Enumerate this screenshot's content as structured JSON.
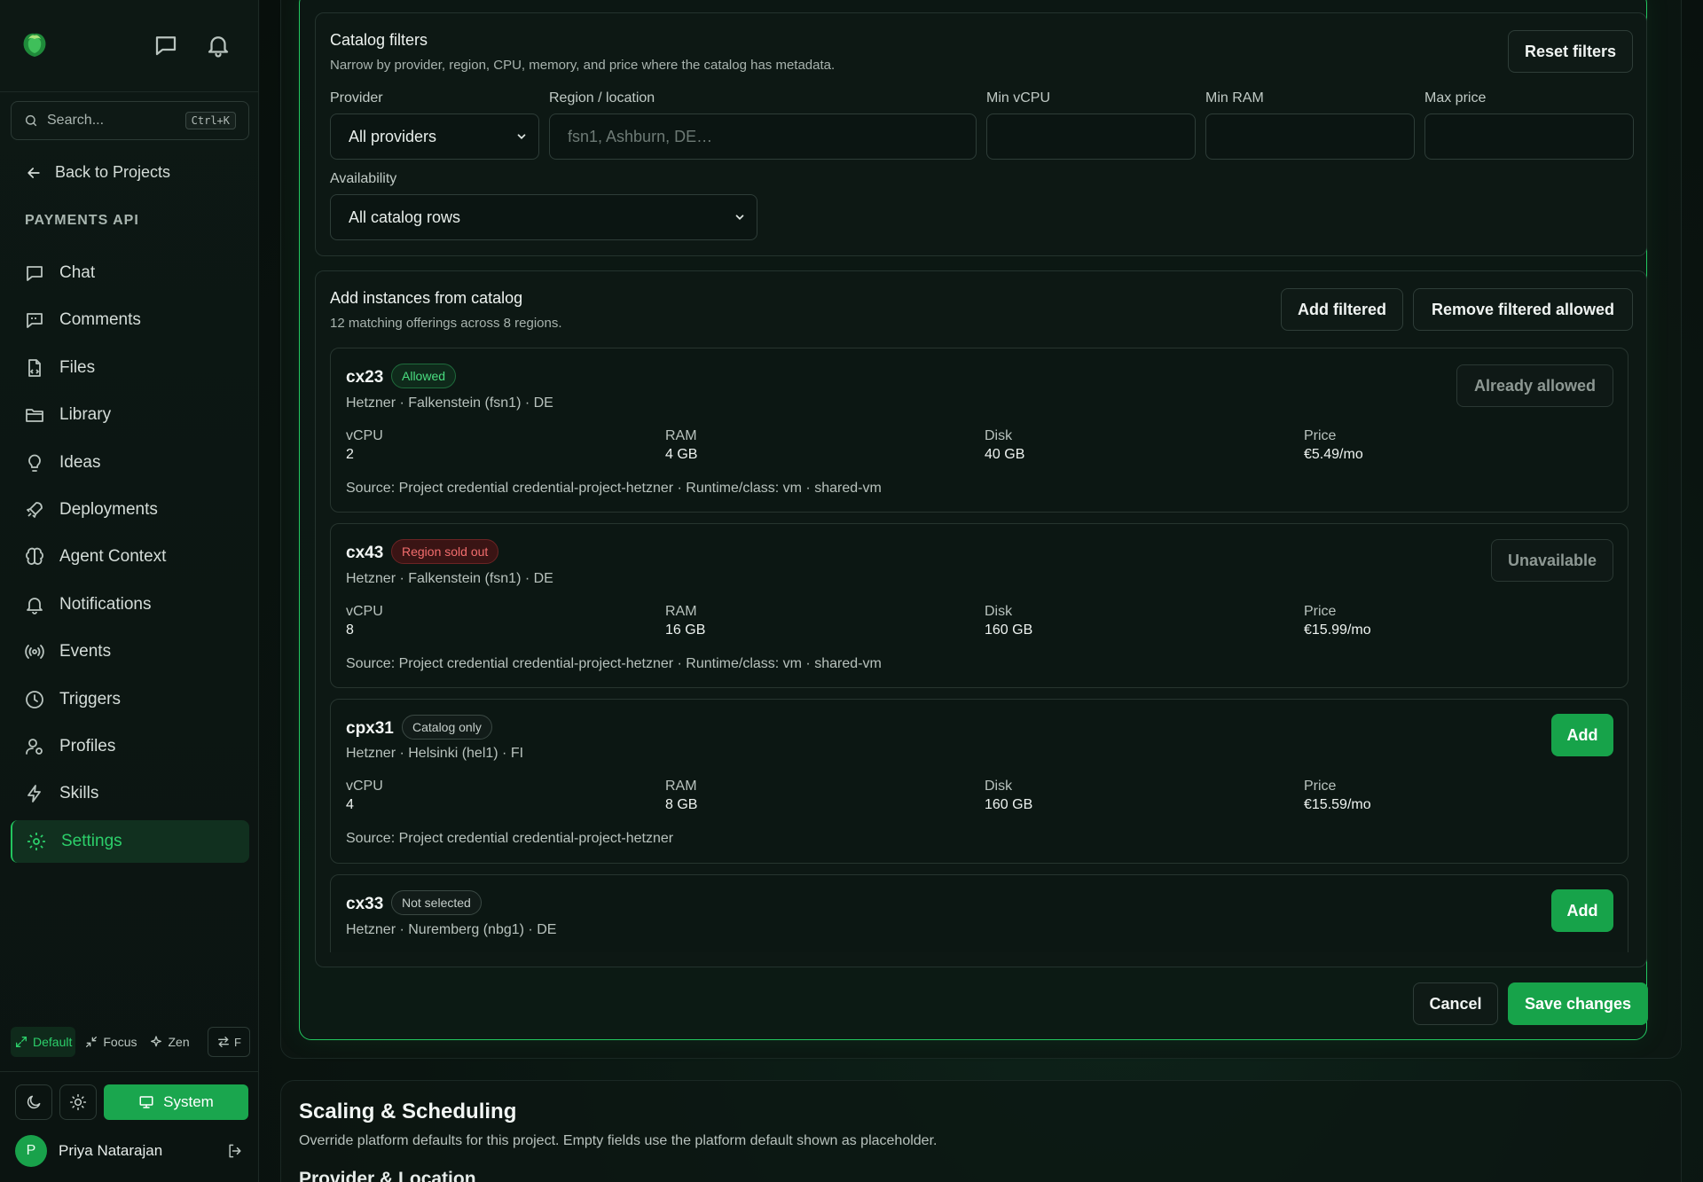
{
  "sidebar": {
    "search_placeholder": "Search...",
    "search_shortcut": "Ctrl+K",
    "back_label": "Back to Projects",
    "project_name": "PAYMENTS API",
    "nav": [
      {
        "label": "Chat",
        "icon": "chat-icon"
      },
      {
        "label": "Comments",
        "icon": "comments-icon"
      },
      {
        "label": "Files",
        "icon": "file-icon"
      },
      {
        "label": "Library",
        "icon": "folder-icon"
      },
      {
        "label": "Ideas",
        "icon": "lightbulb-icon"
      },
      {
        "label": "Deployments",
        "icon": "rocket-icon"
      },
      {
        "label": "Agent Context",
        "icon": "brain-icon"
      },
      {
        "label": "Notifications",
        "icon": "bell-icon"
      },
      {
        "label": "Events",
        "icon": "broadcast-icon"
      },
      {
        "label": "Triggers",
        "icon": "clock-icon"
      },
      {
        "label": "Profiles",
        "icon": "user-cog-icon"
      },
      {
        "label": "Skills",
        "icon": "lightning-icon"
      },
      {
        "label": "Settings",
        "icon": "gear-icon",
        "active": true
      }
    ],
    "modes": {
      "default": "Default",
      "focus": "Focus",
      "zen": "Zen",
      "swap": "F"
    },
    "theme_system": "System",
    "user_name": "Priya Natarajan",
    "user_initial": "P"
  },
  "filters": {
    "title": "Catalog filters",
    "subtitle": "Narrow by provider, region, CPU, memory, and price where the catalog has metadata.",
    "reset_label": "Reset filters",
    "provider_label": "Provider",
    "provider_value": "All providers",
    "region_label": "Region / location",
    "region_placeholder": "fsn1, Ashburn, DE…",
    "min_vcpu_label": "Min vCPU",
    "min_ram_label": "Min RAM",
    "max_price_label": "Max price",
    "availability_label": "Availability",
    "availability_value": "All catalog rows"
  },
  "catalog": {
    "title": "Add instances from catalog",
    "subtitle": "12 matching offerings across 8 regions.",
    "add_filtered_label": "Add filtered",
    "remove_filtered_label": "Remove filtered allowed",
    "spec_labels": {
      "vcpu": "vCPU",
      "ram": "RAM",
      "disk": "Disk",
      "price": "Price"
    },
    "offerings": [
      {
        "name": "cx23",
        "badge": "Allowed",
        "location": "Hetzner · Falkenstein (fsn1) · DE",
        "vcpu": "2",
        "ram": "4 GB",
        "disk": "40 GB",
        "price": "€5.49/mo",
        "source": "Source: Project credential credential-project-hetzner · Runtime/class: vm · shared-vm",
        "action": "Already allowed"
      },
      {
        "name": "cx43",
        "badge": "Region sold out",
        "location": "Hetzner · Falkenstein (fsn1) · DE",
        "vcpu": "8",
        "ram": "16 GB",
        "disk": "160 GB",
        "price": "€15.99/mo",
        "source": "Source: Project credential credential-project-hetzner · Runtime/class: vm · shared-vm",
        "action": "Unavailable"
      },
      {
        "name": "cpx31",
        "badge": "Catalog only",
        "location": "Hetzner · Helsinki (hel1) · FI",
        "vcpu": "4",
        "ram": "8 GB",
        "disk": "160 GB",
        "price": "€15.59/mo",
        "source": "Source: Project credential credential-project-hetzner",
        "action": "Add"
      },
      {
        "name": "cx33",
        "badge": "Not selected",
        "location": "Hetzner · Nuremberg (nbg1) · DE",
        "action": "Add"
      }
    ]
  },
  "footer": {
    "cancel_label": "Cancel",
    "save_label": "Save changes"
  },
  "scaling": {
    "title": "Scaling & Scheduling",
    "subtitle": "Override platform defaults for this project. Empty fields use the platform default shown as placeholder.",
    "next_heading": "Provider & Location"
  },
  "colors": {
    "accent": "#22c55e",
    "danger": "#f26d6d",
    "background": "#0a1210"
  }
}
